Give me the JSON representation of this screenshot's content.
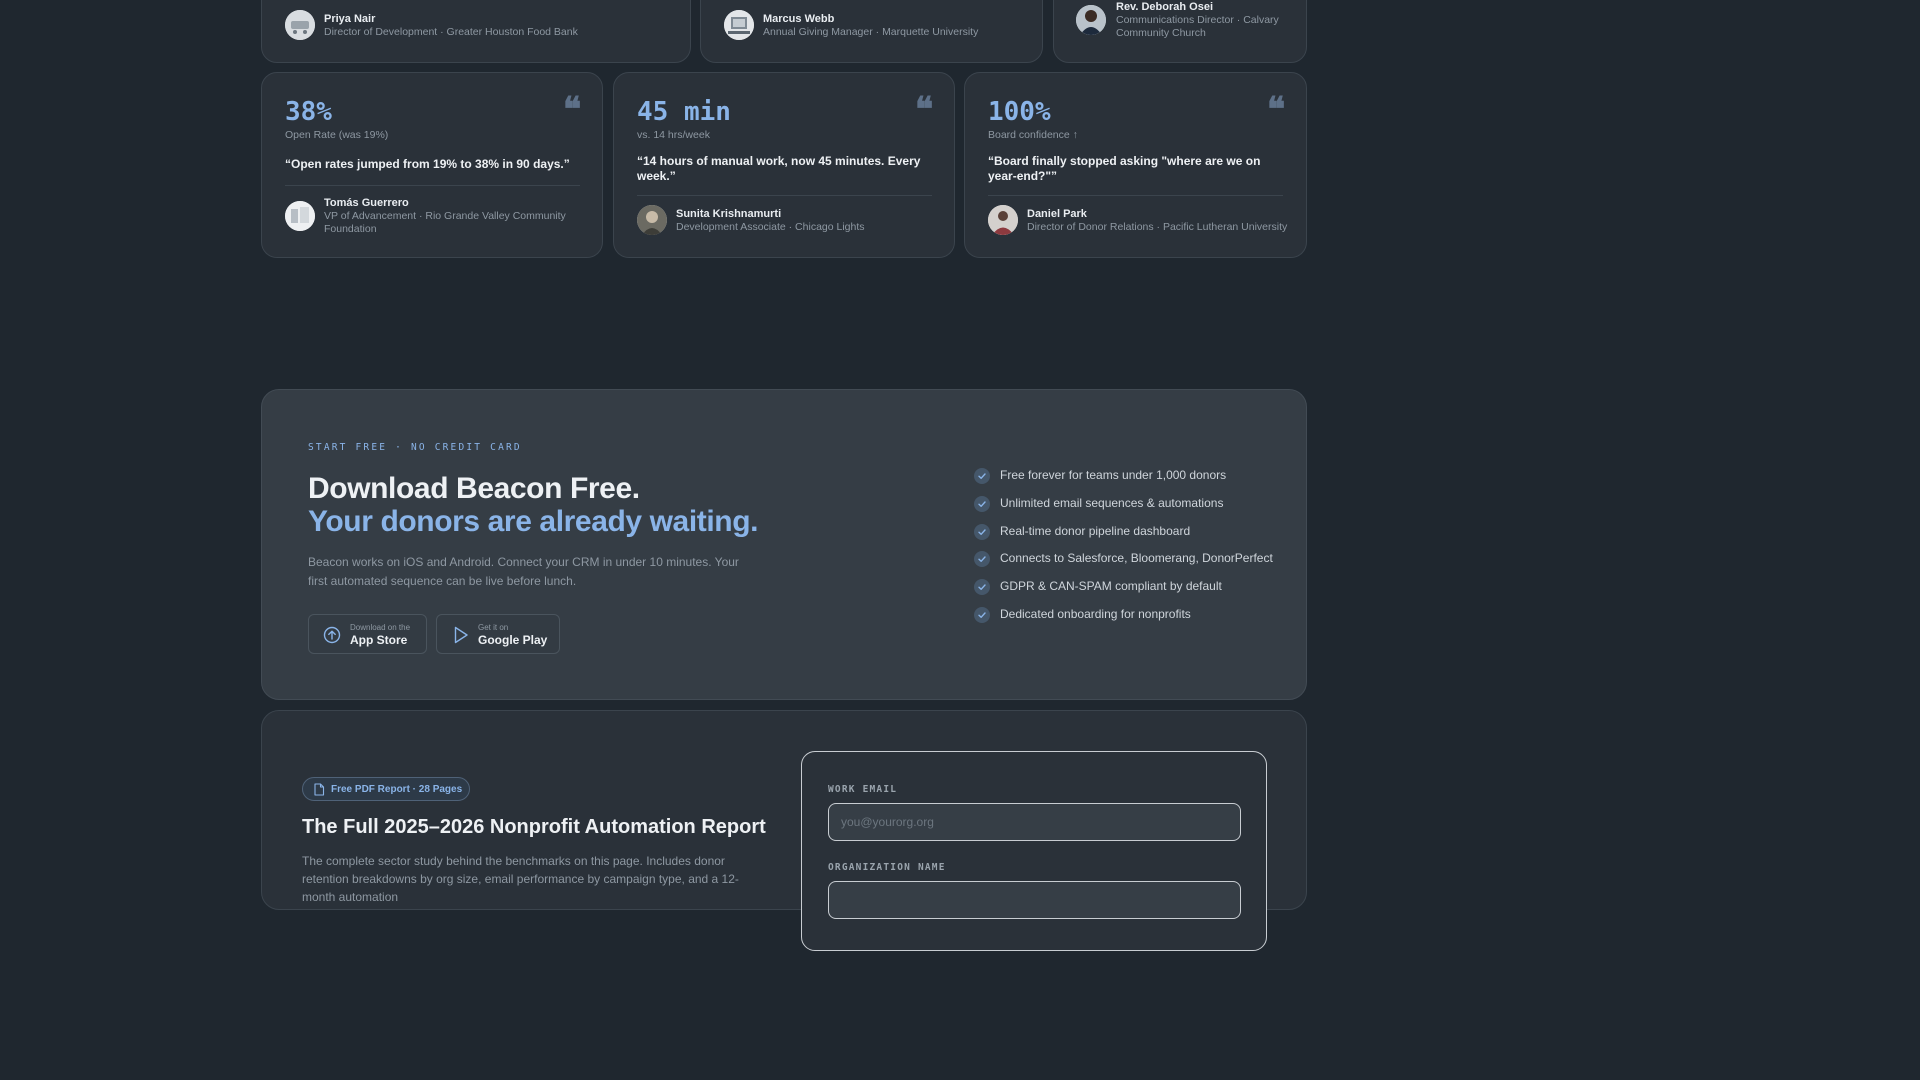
{
  "top_row": [
    {
      "name": "Priya Nair",
      "role": "Director of Development · Greater Houston Food Bank"
    },
    {
      "name": "Marcus Webb",
      "role": "Annual Giving Manager · Marquette University"
    },
    {
      "name": "Rev. Deborah Osei",
      "role": "Communications Director · Calvary Community Church"
    }
  ],
  "stats": [
    {
      "value": "38%",
      "label": "Open Rate (was 19%)",
      "quote": "“Open rates jumped from 19% to 38% in 90 days.”",
      "name": "Tomás Guerrero",
      "role": "VP of Advancement · Rio Grande Valley Community Foundation"
    },
    {
      "value": "45 min",
      "label": "vs. 14 hrs/week",
      "quote": "“14 hours of manual work, now 45 minutes. Every week.”",
      "name": "Sunita Krishnamurti",
      "role": "Development Associate · Chicago Lights"
    },
    {
      "value": "100%",
      "label": "Board confidence ↑",
      "quote": "“Board finally stopped asking \"where are we on year-end?\"”",
      "name": "Daniel Park",
      "role": "Director of Donor Relations · Pacific Lutheran University"
    }
  ],
  "quote_glyph": "❝",
  "cta": {
    "eyebrow": "START FREE · NO CREDIT CARD",
    "headline_line1": "Download Beacon Free.",
    "headline_line2": "Your donors are already waiting.",
    "lead": "Beacon works on iOS and Android. Connect your CRM in under 10 minutes. Your first automated sequence can be live before lunch.",
    "app_store": {
      "small": "Download on the",
      "big": "App Store"
    },
    "google_play": {
      "small": "Get it on",
      "big": "Google Play"
    },
    "features": [
      "Free forever for teams under 1,000 donors",
      "Unlimited email sequences & automations",
      "Real-time donor pipeline dashboard",
      "Connects to Salesforce, Bloomerang, DonorPerfect",
      "GDPR & CAN-SPAM compliant by default",
      "Dedicated onboarding for nonprofits"
    ],
    "accent_color": "#8ab4e8"
  },
  "report": {
    "badge": "Free PDF Report · 28 Pages",
    "title": "The Full 2025–2026 Nonprofit Automation Report",
    "desc": "The complete sector study behind the benchmarks on this page. Includes donor retention breakdowns by org size, email performance by campaign type, and a 12-month automation",
    "email_label": "WORK EMAIL",
    "email_placeholder": "you@yourorg.org",
    "org_label": "ORGANIZATION NAME"
  }
}
